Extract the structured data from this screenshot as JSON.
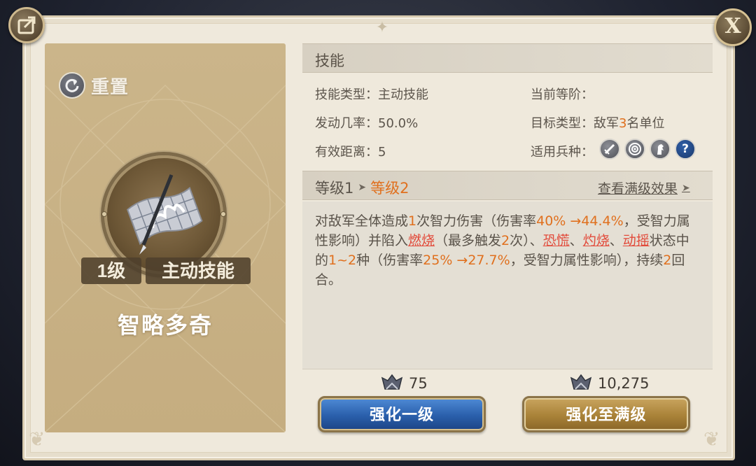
{
  "header": {
    "close_label": "X"
  },
  "skill_card": {
    "reset_label": "重置",
    "level_badge": "1级",
    "type_badge": "主动技能",
    "name": "智略多奇"
  },
  "skill_section": {
    "title": "技能",
    "type_label": "技能类型：",
    "type_value": "主动技能",
    "rate_label": "发动几率：",
    "rate_value": "50.0%",
    "range_label": "有效距离：",
    "range_value": "5",
    "tier_label": "当前等阶：",
    "target_label": "目标类型：",
    "target_prefix": "敌军",
    "target_count": "3",
    "target_suffix": "名单位",
    "troop_label": "适用兵种：",
    "troop_icons": [
      "sword-icon",
      "target-icon",
      "horse-icon",
      "question-icon"
    ],
    "unknown_troop_mark": "?"
  },
  "level_section": {
    "current": "等级1",
    "next": "等级2",
    "view_full_label": "查看满级效果"
  },
  "description": {
    "p1": "对敌军全体造成",
    "n1": "1",
    "p2": "次智力伤害（伤害率",
    "n2": "40% →44.4%",
    "p3": "，受智力属性影响）并陷入",
    "s1": "燃烧",
    "p4": "（最多触发",
    "n3": "2",
    "p5": "次）、",
    "s2": "恐慌",
    "p6": "、",
    "s3": "灼烧",
    "p7": "、",
    "s4": "动摇",
    "p8": "状态中的",
    "n4": "1~2",
    "p9": "种（伤害率",
    "n5": "25% →27.7%",
    "p10": "，受智力属性影响），持续",
    "n6": "2",
    "p11": "回合。"
  },
  "costs": {
    "upgrade_one": "75",
    "upgrade_max": "10,275"
  },
  "buttons": {
    "upgrade_one_label": "强化一级",
    "upgrade_max_label": "强化至满级"
  },
  "colors": {
    "highlight_orange": "#e0701e",
    "status_red": "#e24a3a",
    "blue_button": "#2a5fab",
    "gold_button": "#a98238"
  }
}
